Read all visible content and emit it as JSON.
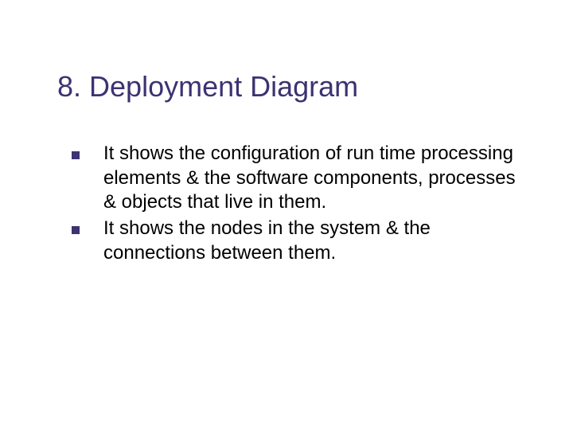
{
  "slide": {
    "title": "8. Deployment Diagram",
    "bullets": [
      "It shows the configuration of run time processing elements & the software components, processes & objects that live in them.",
      "It shows the nodes in the system & the connections between them."
    ]
  }
}
